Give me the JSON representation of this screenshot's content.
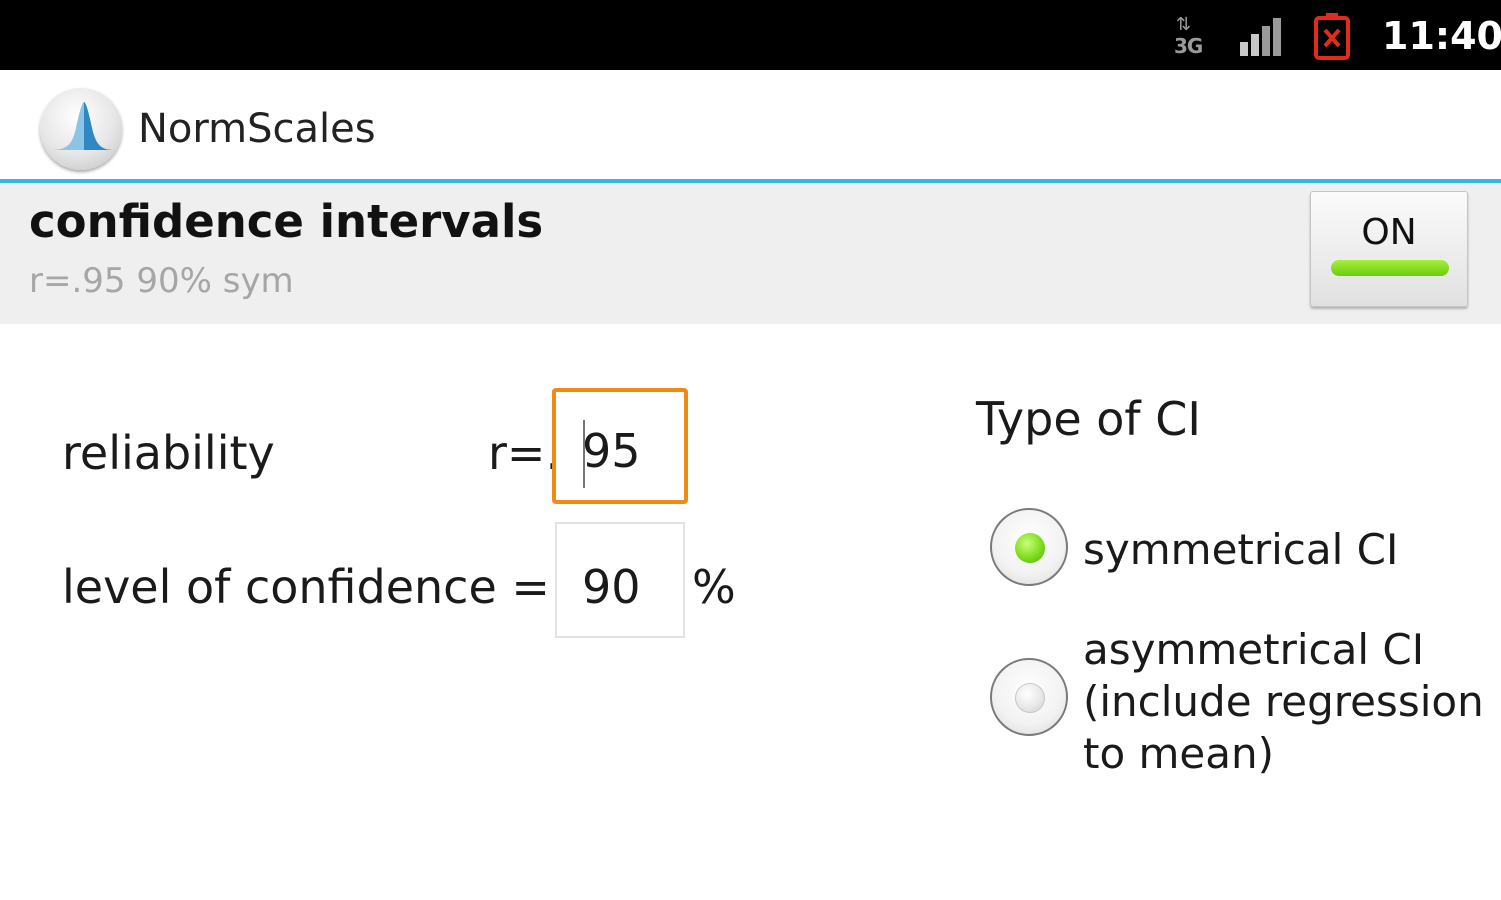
{
  "status_bar": {
    "network_type": "3G",
    "network_icon": "3g-data-icon",
    "signal_icon": "signal-strength-icon",
    "battery_icon": "battery-alert-icon",
    "time": "11:40"
  },
  "action_bar": {
    "app_icon": "normal-distribution-icon",
    "title": "NormScales",
    "accent_color": "#33b5e5"
  },
  "pref_header": {
    "title": "confidence intervals",
    "summary": "r=.95 90% sym",
    "toggle_label": "ON",
    "toggle_state": "on",
    "toggle_color": "#7fdc1e"
  },
  "form": {
    "reliability_label": "reliability",
    "reliability_prefix": "r=.",
    "reliability_value": "95",
    "confidence_label": "level of confidence =",
    "confidence_value": "90",
    "confidence_unit": "%"
  },
  "ci_type": {
    "title": "Type of CI",
    "options": [
      {
        "label": "symmetrical CI",
        "selected": true
      },
      {
        "label_lines": [
          "asymmetrical CI",
          "(include regression",
          "to mean)"
        ],
        "selected": false
      }
    ]
  }
}
